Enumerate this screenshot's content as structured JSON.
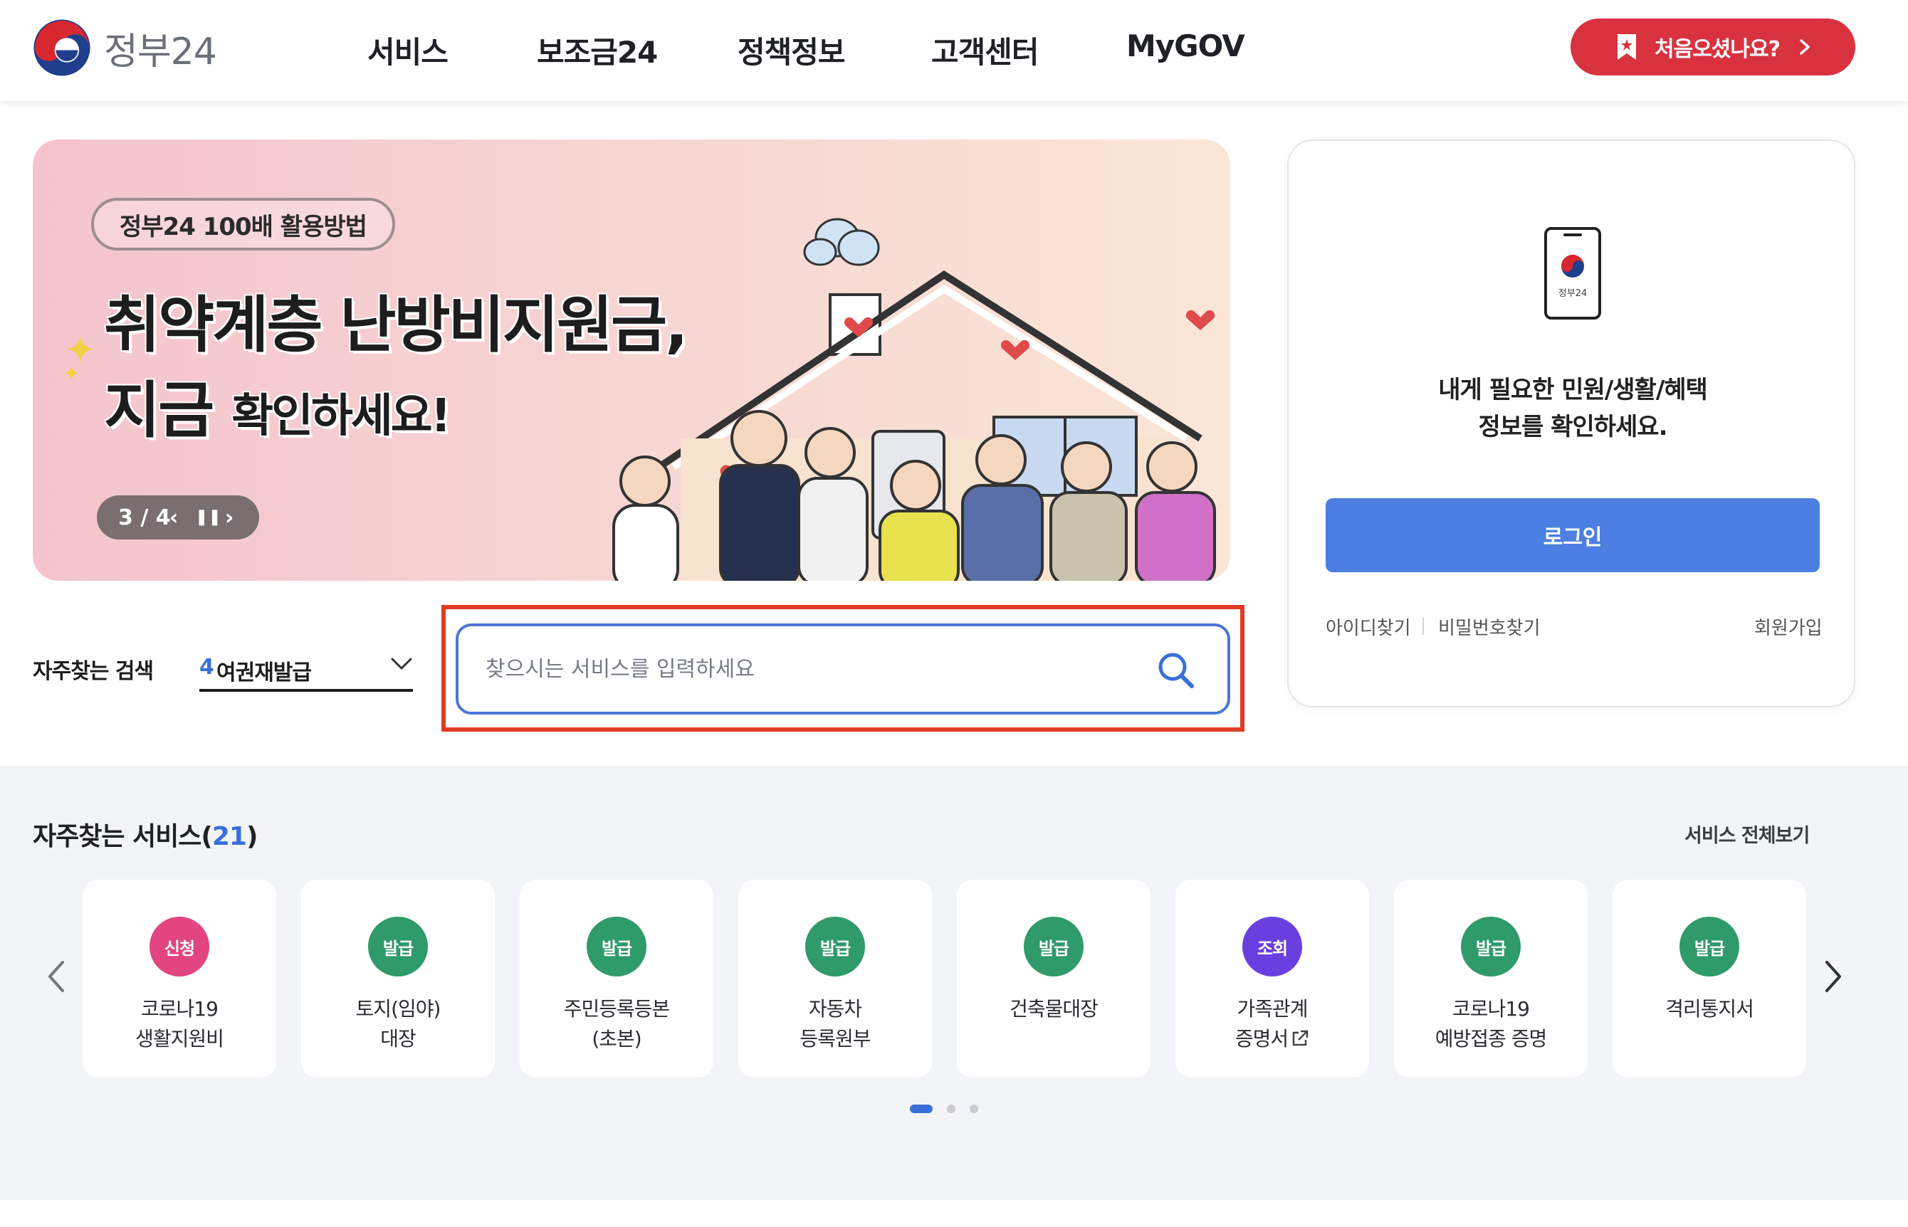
{
  "header": {
    "logo_text": "정부24",
    "nav": [
      "서비스",
      "보조금24",
      "정책정보",
      "고객센터",
      "MyGOV"
    ],
    "first_visit_label": "처음오셨나요?"
  },
  "banner": {
    "pill": "정부24 100배 활용방법",
    "line1": "취약계층 난방비지원금,",
    "line2_big": "지금",
    "line2_small": "확인하세요!",
    "pager": "3 / 4"
  },
  "login": {
    "message_line1": "내게 필요한 민원/생활/혜택",
    "message_line2": "정보를 확인하세요.",
    "phone_label": "정부24",
    "login_button": "로그인",
    "find_id": "아이디찾기",
    "find_pw": "비밀번호찾기",
    "signup": "회원가입"
  },
  "search": {
    "freq_label": "자주찾는 검색",
    "freq_rank": "4",
    "freq_term": "여권재발급",
    "placeholder": "찾으시는 서비스를 입력하세요"
  },
  "services": {
    "title": "자주찾는 서비스",
    "count": "21",
    "all_link": "서비스 전체보기",
    "items": [
      {
        "badge": "신청",
        "badge_color": "#e2457f",
        "line1": "코로나19",
        "line2": "생활지원비"
      },
      {
        "badge": "발급",
        "badge_color": "#2f9a6a",
        "line1": "토지(임야)",
        "line2": "대장"
      },
      {
        "badge": "발급",
        "badge_color": "#2f9a6a",
        "line1": "주민등록등본",
        "line2": "(초본)"
      },
      {
        "badge": "발급",
        "badge_color": "#2f9a6a",
        "line1": "자동차",
        "line2": "등록원부"
      },
      {
        "badge": "발급",
        "badge_color": "#2f9a6a",
        "line1": "건축물대장",
        "line2": ""
      },
      {
        "badge": "조회",
        "badge_color": "#6a3fe0",
        "line1": "가족관계",
        "line2": "증명서"
      },
      {
        "badge": "발급",
        "badge_color": "#2f9a6a",
        "line1": "코로나19",
        "line2": "예방접종 증명"
      },
      {
        "badge": "발급",
        "badge_color": "#2f9a6a",
        "line1": "격리통지서",
        "line2": ""
      }
    ]
  },
  "colors": {
    "brand_red": "#d9323f",
    "accent_blue": "#4d7fe2",
    "highlight": "#e03a25"
  }
}
